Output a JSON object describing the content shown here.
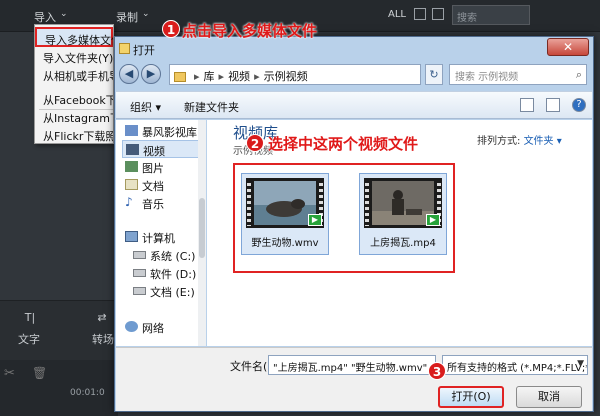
{
  "app": {
    "menu_import": "导入",
    "menu_record": "录制",
    "filter_all": "ALL",
    "search_placeholder": "搜索",
    "tool_text": "文字",
    "tool_transition": "转场",
    "timecode": "00:01:0"
  },
  "import_menu": {
    "items": [
      "导入多媒体文件(X)...",
      "导入文件夹(Y)...",
      "从相机或手机导入",
      "从Facebook下载",
      "从Instagram下载",
      "从Flickr下载照片"
    ]
  },
  "callouts": {
    "step1_num": "1",
    "step1_text": "点击导入多媒体文件",
    "step2_num": "2",
    "step2_text": "选择中这两个视频文件",
    "step3_num": "3"
  },
  "dialog": {
    "title": "打开",
    "close": "✕",
    "path": [
      "库",
      "视频",
      "示例视频"
    ],
    "search_placeholder": "搜索 示例视频",
    "toolbar": {
      "organize": "组织 ▾",
      "new_folder": "新建文件夹"
    },
    "sidebar": {
      "items": [
        "暴风影视库",
        "视频",
        "图片",
        "文档",
        "音乐",
        "计算机",
        "系统 (C:)",
        "软件 (D:)",
        "文档 (E:)",
        "网络"
      ]
    },
    "library": {
      "title": "视频库",
      "subtitle": "示例视频",
      "arrange_label": "排列方式:",
      "arrange_value": "文件夹 ▾"
    },
    "files": [
      {
        "name": "野生动物.wmv"
      },
      {
        "name": "上房揭瓦.mp4"
      }
    ],
    "filename_label": "文件名(N):",
    "filename_value": "\"上房揭瓦.mp4\" \"野生动物.wmv\"",
    "filetype_value": "所有支持的格式 (*.MP4;*.FLV;*",
    "open_button": "打开(O)",
    "cancel_button": "取消"
  },
  "colors": {
    "highlight_red": "#e02323",
    "accent_blue": "#1e4e8c"
  }
}
